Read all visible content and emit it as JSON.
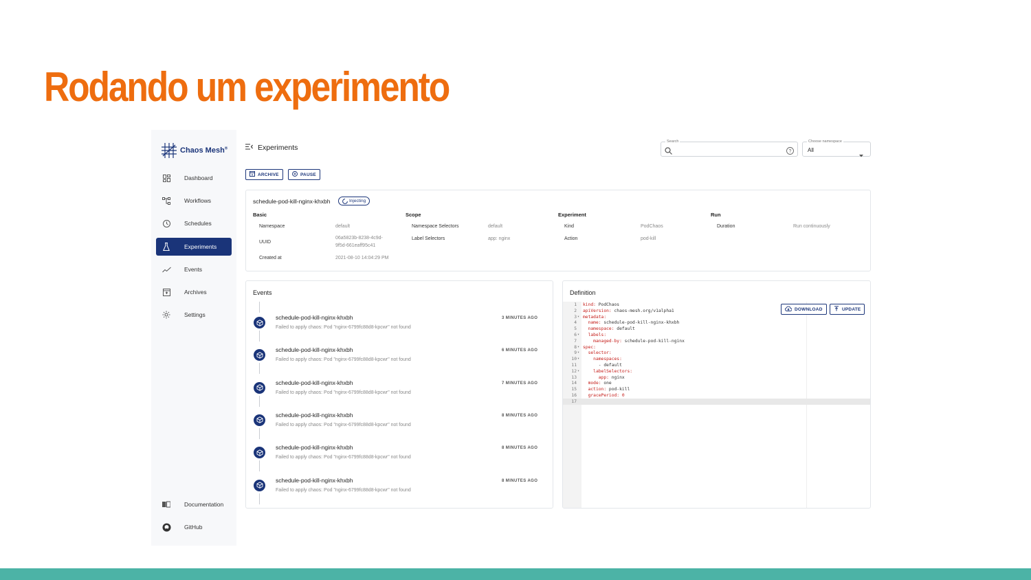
{
  "slide": {
    "title": "Rodando um experimento"
  },
  "colors": {
    "title_orange": "#ee6d0f",
    "footer_teal": "#4cb3a6",
    "brand_navy": "#1a3479"
  },
  "sidebar": {
    "brand": "Chaos Mesh",
    "brand_mark": "®",
    "items": [
      {
        "label": "Dashboard",
        "icon": "dashboard-icon"
      },
      {
        "label": "Workflows",
        "icon": "workflows-icon"
      },
      {
        "label": "Schedules",
        "icon": "clock-icon"
      },
      {
        "label": "Experiments",
        "icon": "flask-icon",
        "active": true
      },
      {
        "label": "Events",
        "icon": "trend-icon"
      },
      {
        "label": "Archives",
        "icon": "archive-icon"
      },
      {
        "label": "Settings",
        "icon": "gear-icon"
      }
    ],
    "bottom_items": [
      {
        "label": "Documentation",
        "icon": "book-icon"
      },
      {
        "label": "GitHub",
        "icon": "github-icon"
      }
    ]
  },
  "header": {
    "title": "Experiments",
    "search": {
      "label": "Search",
      "value": ""
    },
    "namespace": {
      "label": "Choose namespace",
      "value": "All"
    }
  },
  "toolbar": {
    "archive": "ARCHIVE",
    "pause": "PAUSE"
  },
  "experiment": {
    "name": "schedule-pod-kill-nginx-khxbh",
    "status": "Injecting",
    "sections": {
      "basic": "Basic",
      "scope": "Scope",
      "experiment": "Experiment",
      "run": "Run"
    },
    "basic": {
      "namespace_label": "Namespace",
      "namespace_value": "default",
      "uuid_label": "UUID",
      "uuid_value_1": "06a5823b-8238-4c9d-",
      "uuid_value_2": "9f5d-661eaff95c41",
      "created_label": "Created at",
      "created_value": "2021-08-10 14:04:29 PM"
    },
    "scope": {
      "ns_selectors_label": "Namespace Selectors",
      "ns_selectors_value": "default",
      "label_selectors_label": "Label Selectors",
      "label_selectors_value": "app: nginx"
    },
    "experiment": {
      "kind_label": "Kind",
      "kind_value": "PodChaos",
      "action_label": "Action",
      "action_value": "pod-kill"
    },
    "run": {
      "duration_label": "Duration",
      "duration_value": "Run continuously"
    }
  },
  "events": {
    "title": "Events",
    "items": [
      {
        "title": "schedule-pod-kill-nginx-khxbh",
        "message": "Failed to apply chaos: Pod \"nginx-6799fc88d8-kpcwr\" not found",
        "time": "3 MINUTES AGO"
      },
      {
        "title": "schedule-pod-kill-nginx-khxbh",
        "message": "Failed to apply chaos: Pod \"nginx-6799fc88d8-kpcwr\" not found",
        "time": "6 MINUTES AGO"
      },
      {
        "title": "schedule-pod-kill-nginx-khxbh",
        "message": "Failed to apply chaos: Pod \"nginx-6799fc88d8-kpcwr\" not found",
        "time": "7 MINUTES AGO"
      },
      {
        "title": "schedule-pod-kill-nginx-khxbh",
        "message": "Failed to apply chaos: Pod \"nginx-6799fc88d8-kpcwr\" not found",
        "time": "8 MINUTES AGO"
      },
      {
        "title": "schedule-pod-kill-nginx-khxbh",
        "message": "Failed to apply chaos: Pod \"nginx-6799fc88d8-kpcwr\" not found",
        "time": "8 MINUTES AGO"
      },
      {
        "title": "schedule-pod-kill-nginx-khxbh",
        "message": "Failed to apply chaos: Pod \"nginx-6799fc88d8-kpcwr\" not found",
        "time": "8 MINUTES AGO"
      }
    ]
  },
  "definition": {
    "title": "Definition",
    "download": "DOWNLOAD",
    "update": "UPDATE",
    "lines": [
      {
        "n": "1",
        "fold": "",
        "indent": "",
        "key": "kind:",
        "val": " PodChaos"
      },
      {
        "n": "2",
        "fold": "",
        "indent": "",
        "key": "apiVersion:",
        "val": " chaos-mesh.org/v1alpha1"
      },
      {
        "n": "3",
        "fold": "▾",
        "indent": "",
        "key": "metadata:",
        "val": ""
      },
      {
        "n": "4",
        "fold": "",
        "indent": "  ",
        "key": "name:",
        "val": " schedule-pod-kill-nginx-khxbh"
      },
      {
        "n": "5",
        "fold": "",
        "indent": "  ",
        "key": "namespace:",
        "val": " default"
      },
      {
        "n": "6",
        "fold": "▾",
        "indent": "  ",
        "key": "labels:",
        "val": ""
      },
      {
        "n": "7",
        "fold": "",
        "indent": "    ",
        "key": "managed-by:",
        "val": " schedule-pod-kill-nginx"
      },
      {
        "n": "8",
        "fold": "▾",
        "indent": "",
        "key": "spec:",
        "val": ""
      },
      {
        "n": "9",
        "fold": "▾",
        "indent": "  ",
        "key": "selector:",
        "val": ""
      },
      {
        "n": "10",
        "fold": "▾",
        "indent": "    ",
        "key": "namespaces:",
        "val": ""
      },
      {
        "n": "11",
        "fold": "",
        "indent": "      ",
        "key": "",
        "val": "- default"
      },
      {
        "n": "12",
        "fold": "▾",
        "indent": "    ",
        "key": "labelSelectors:",
        "val": ""
      },
      {
        "n": "13",
        "fold": "",
        "indent": "      ",
        "key": "app:",
        "val": " nginx"
      },
      {
        "n": "14",
        "fold": "",
        "indent": "  ",
        "key": "mode:",
        "val": " one"
      },
      {
        "n": "15",
        "fold": "",
        "indent": "  ",
        "key": "action:",
        "val": " pod-kill"
      },
      {
        "n": "16",
        "fold": "",
        "indent": "  ",
        "key": "gracePeriod:",
        "val": " 0",
        "num": true
      },
      {
        "n": "17",
        "fold": "",
        "indent": "",
        "key": "",
        "val": "",
        "current": true
      }
    ]
  }
}
